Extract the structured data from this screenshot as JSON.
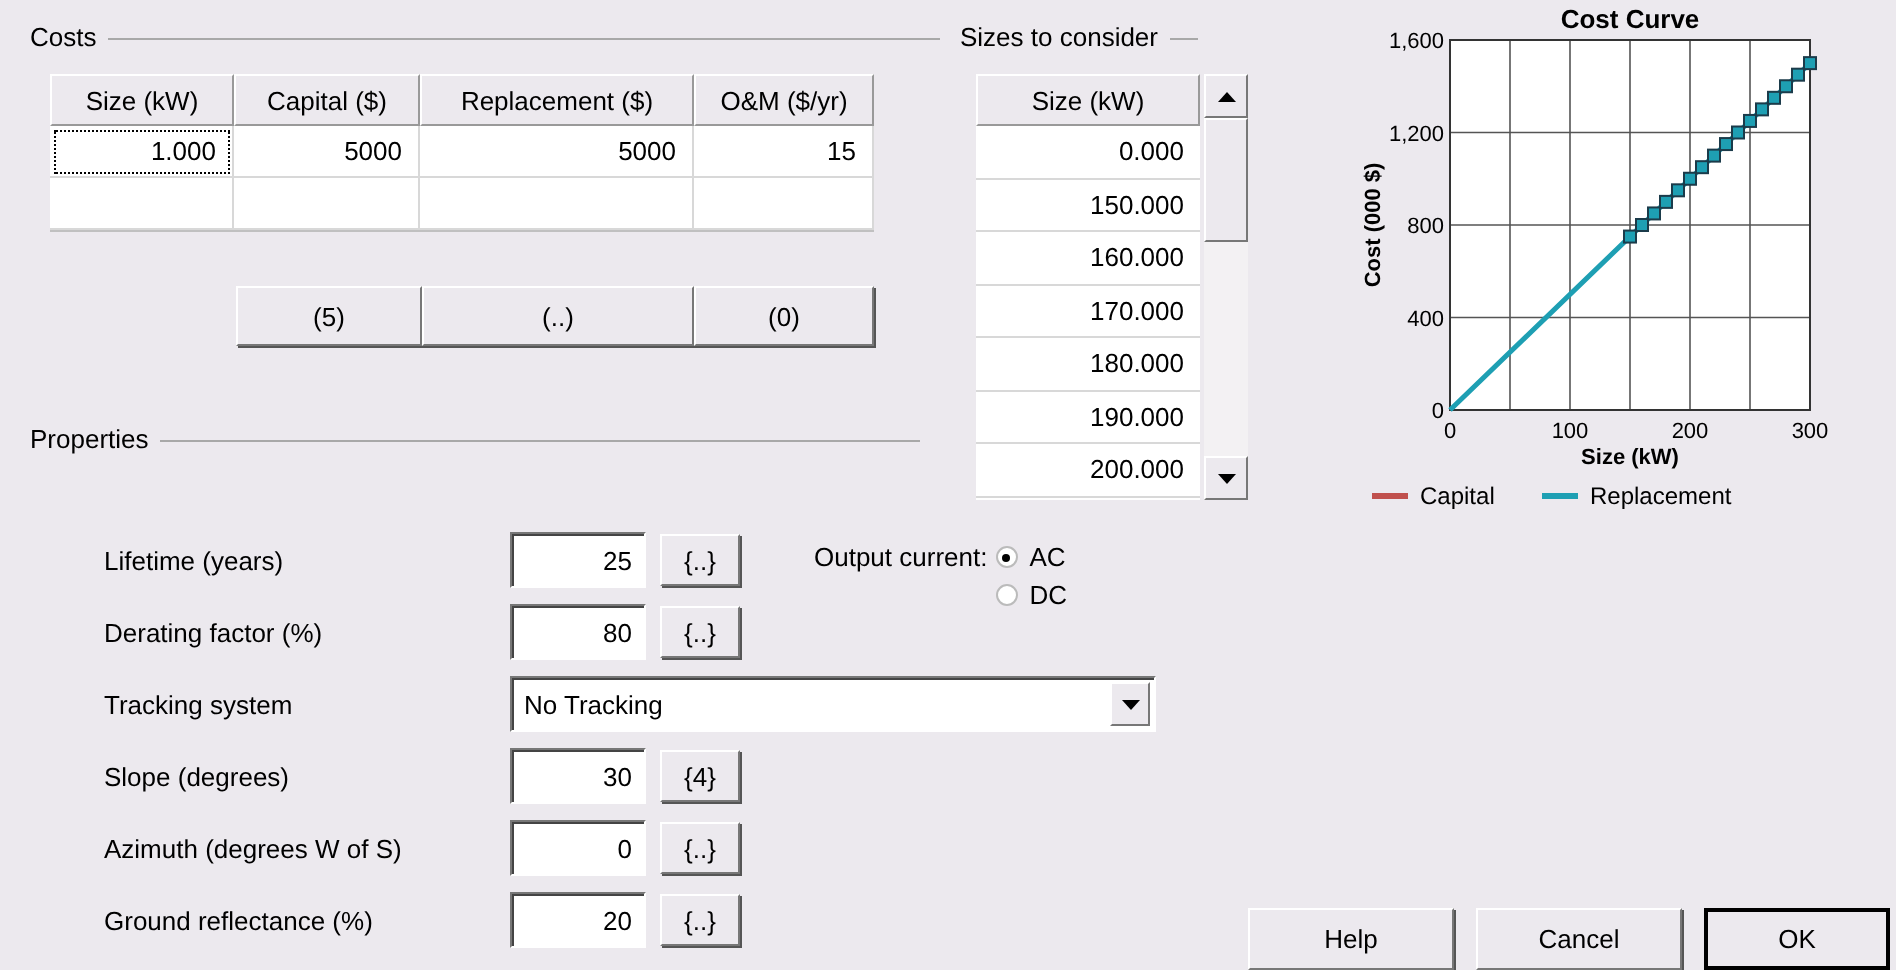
{
  "costs": {
    "title": "Costs",
    "columns": [
      "Size (kW)",
      "Capital ($)",
      "Replacement ($)",
      "O&M ($/yr)"
    ],
    "rows": [
      [
        "1.000",
        "5000",
        "5000",
        "15"
      ]
    ],
    "buttons": [
      "(5)",
      "(..)",
      "(0)"
    ]
  },
  "sizes": {
    "title": "Sizes to consider",
    "column": "Size (kW)",
    "rows": [
      "0.000",
      "150.000",
      "160.000",
      "170.000",
      "180.000",
      "190.000",
      "200.000"
    ]
  },
  "chart": {
    "chart_data": {
      "type": "line",
      "title": "Cost Curve",
      "xlabel": "Size (kW)",
      "ylabel": "Cost (000 $)",
      "x": [
        0,
        150,
        160,
        170,
        180,
        190,
        200,
        210,
        220,
        230,
        240,
        250,
        260,
        270,
        280,
        290,
        300
      ],
      "series": [
        {
          "name": "Capital",
          "color": "#c0504d",
          "values": [
            null,
            null,
            null,
            null,
            null,
            null,
            null,
            null,
            null,
            null,
            null,
            null,
            null,
            null,
            null,
            null,
            null
          ]
        },
        {
          "name": "Replacement",
          "color": "#1e9fb3",
          "marker": "square",
          "values": [
            0,
            750,
            800,
            850,
            900,
            950,
            1000,
            1050,
            1100,
            1150,
            1200,
            1250,
            1300,
            1350,
            1400,
            1450,
            1500
          ]
        }
      ],
      "grid": true,
      "legend": "bottom",
      "xlim": [
        0,
        300
      ],
      "ylim": [
        0,
        1600
      ],
      "xticks": [
        0,
        100,
        200,
        300
      ],
      "yticks": [
        0,
        400,
        800,
        {
          "value": 1200,
          "label": "1,200"
        },
        {
          "value": 1600,
          "label": "1,600"
        }
      ]
    }
  },
  "properties": {
    "title": "Properties",
    "rows": [
      {
        "kind": "input",
        "label": "Lifetime (years)",
        "value": "25",
        "button": "{..}"
      },
      {
        "kind": "input",
        "label": "Derating factor (%)",
        "value": "80",
        "button": "{..}"
      },
      {
        "kind": "dropdown",
        "label": "Tracking system",
        "value": "No Tracking"
      },
      {
        "kind": "input",
        "label": "Slope (degrees)",
        "value": "30",
        "button": "{4}"
      },
      {
        "kind": "input",
        "label": "Azimuth (degrees W of S)",
        "value": "0",
        "button": "{..}"
      },
      {
        "kind": "input",
        "label": "Ground reflectance (%)",
        "value": "20",
        "button": "{..}"
      }
    ],
    "output_current": {
      "label": "Output current:",
      "options": [
        {
          "label": "AC",
          "selected": true
        },
        {
          "label": "DC",
          "selected": false
        }
      ]
    }
  },
  "buttons": [
    {
      "label": "Help",
      "default": false
    },
    {
      "label": "Cancel",
      "default": false
    },
    {
      "label": "OK",
      "default": true
    }
  ]
}
